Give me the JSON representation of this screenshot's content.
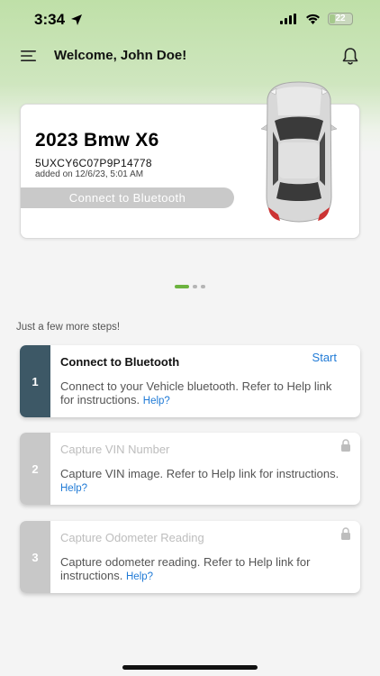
{
  "status_bar": {
    "time": "3:34",
    "battery": "22"
  },
  "header": {
    "welcome": "Welcome, John Doe!"
  },
  "vehicle": {
    "name": "2023 Bmw X6",
    "vin": "5UXCY6C07P9P14778",
    "added_on": "added on 12/6/23, 5:01 AM",
    "connect_label": "Connect to Bluetooth"
  },
  "pager": {
    "count": 3,
    "active": 0
  },
  "steps_heading": "Just a few more steps!",
  "steps": [
    {
      "number": "1",
      "title": "Connect to Bluetooth",
      "description": "Connect to your Vehicle bluetooth. Refer to Help link for instructions.",
      "help": "Help?",
      "action": "Start",
      "locked": false
    },
    {
      "number": "2",
      "title": "Capture VIN Number",
      "description": "Capture VIN image. Refer to Help link for instructions.",
      "help": "Help?",
      "locked": true
    },
    {
      "number": "3",
      "title": "Capture Odometer Reading",
      "description": "Capture odometer reading. Refer to Help link for instructions.",
      "help": "Help?",
      "locked": true
    }
  ],
  "colors": {
    "active_step": "#3d5866",
    "inactive_step": "#c8c8c8",
    "link": "#1f7ad6",
    "accent": "#6cb33f"
  },
  "icons": {
    "menu": "menu-icon",
    "notifications": "bell-icon",
    "location": "location-arrow-icon",
    "lock": "lock-icon"
  }
}
